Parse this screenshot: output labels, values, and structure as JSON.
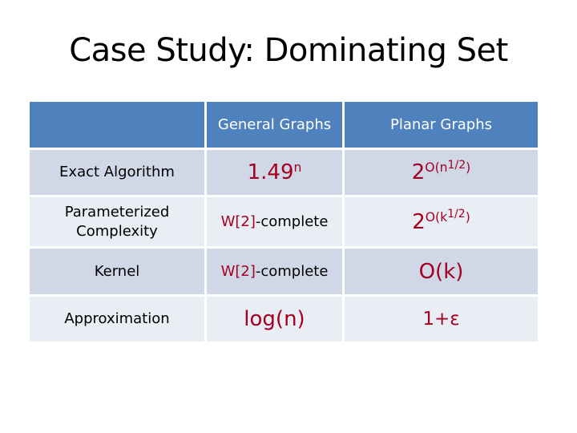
{
  "slide": {
    "title": "Case Study: Dominating Set"
  },
  "colors": {
    "header_bg": "#4f81bd",
    "row_odd_bg": "#d0d8e8",
    "row_even_bg": "#e9edf4",
    "accent_red": "#a50021"
  },
  "table": {
    "headers": [
      "",
      "General Graphs",
      "Planar Graphs"
    ],
    "rows": [
      {
        "label": "Exact Algorithm",
        "general": {
          "base": "1.49",
          "exp": "n"
        },
        "planar": {
          "base": "2",
          "exp_prefix": "O(n",
          "exp_inner": "1/2",
          "exp_suffix": ")"
        }
      },
      {
        "label_line1": "Parameterized",
        "label_line2": "Complexity",
        "general": {
          "red_part": "W[2]",
          "black_part": "-complete"
        },
        "planar": {
          "base": "2",
          "exp_prefix": "O(k",
          "exp_inner": "1/2",
          "exp_suffix": ")"
        }
      },
      {
        "label": "Kernel",
        "general": {
          "red_part": "W[2]",
          "black_part": "-complete"
        },
        "planar": {
          "text": "O(k)"
        }
      },
      {
        "label": "Approximation",
        "general": {
          "text": "log(n)"
        },
        "planar": {
          "text": "1+ε"
        }
      }
    ]
  }
}
